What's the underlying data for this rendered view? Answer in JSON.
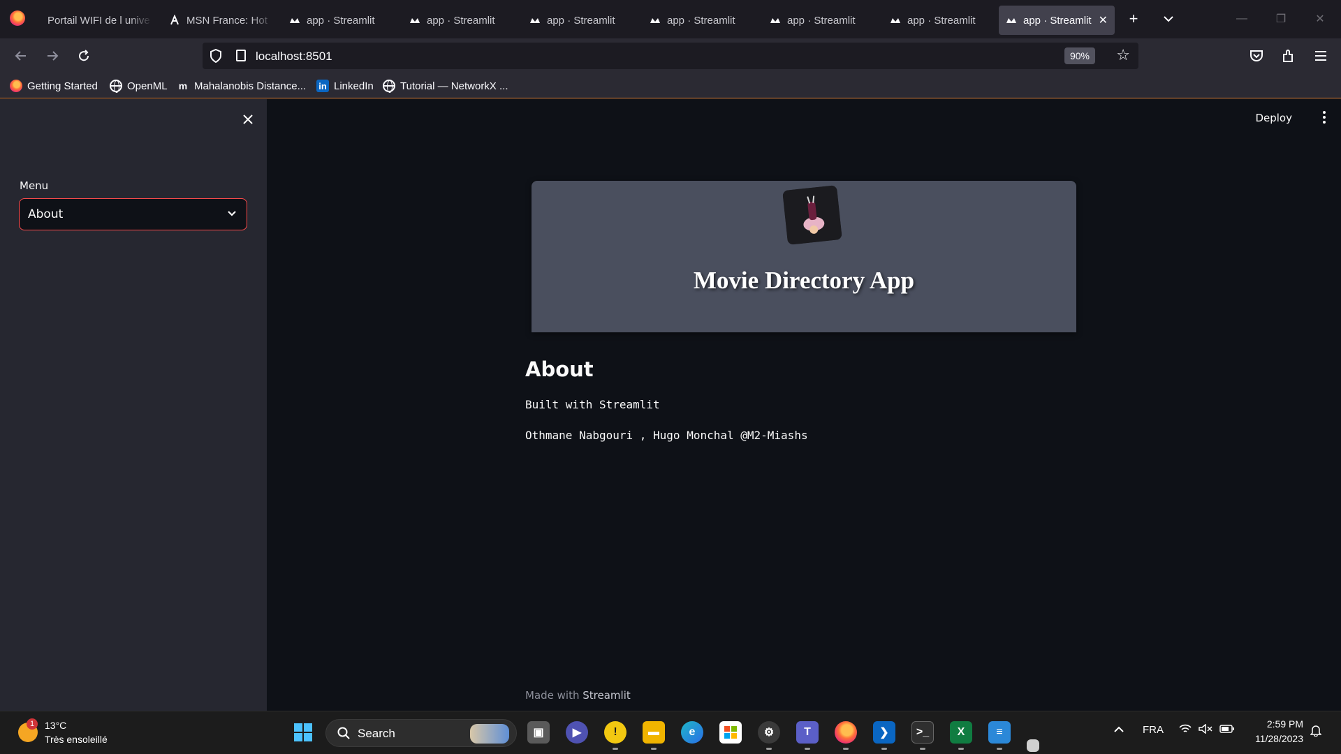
{
  "browser": {
    "tabs": [
      {
        "label": "Portail WIFI de l unive",
        "icon": "page-icon"
      },
      {
        "label": "MSN France: Hot",
        "icon": "msn-icon"
      },
      {
        "label": "app · Streamlit",
        "icon": "streamlit-icon"
      },
      {
        "label": "app · Streamlit",
        "icon": "streamlit-icon"
      },
      {
        "label": "app · Streamlit",
        "icon": "streamlit-icon"
      },
      {
        "label": "app · Streamlit",
        "icon": "streamlit-icon"
      },
      {
        "label": "app · Streamlit",
        "icon": "streamlit-icon"
      },
      {
        "label": "app · Streamlit",
        "icon": "streamlit-icon"
      },
      {
        "label": "app · Streamlit",
        "icon": "streamlit-icon",
        "active": true
      }
    ],
    "url": "localhost:8501",
    "zoom": "90%",
    "bookmarks": [
      {
        "label": "Getting Started",
        "icon": "firefox-icon"
      },
      {
        "label": "OpenML",
        "icon": "globe-icon"
      },
      {
        "label": "Mahalanobis Distance...",
        "icon": "medium-icon"
      },
      {
        "label": "LinkedIn",
        "icon": "linkedin-icon"
      },
      {
        "label": "Tutorial — NetworkX ...",
        "icon": "globe-icon"
      }
    ]
  },
  "app": {
    "deploy_label": "Deploy",
    "sidebar": {
      "menu_label": "Menu",
      "selected": "About"
    },
    "banner_title": "Movie Directory App",
    "heading": "About",
    "lines": [
      "Built with Streamlit",
      "Othmane Nabgouri , Hugo Monchal @M2-Miashs"
    ],
    "footer_prefix": "Made with ",
    "footer_brand": "Streamlit",
    "accent_color": "#ff4b4b"
  },
  "taskbar": {
    "weather_temp": "13°C",
    "weather_desc": "Très ensoleillé",
    "weather_badge": "1",
    "search_placeholder": "Search",
    "language": "FRA",
    "time": "2:59 PM",
    "date": "11/28/2023"
  }
}
